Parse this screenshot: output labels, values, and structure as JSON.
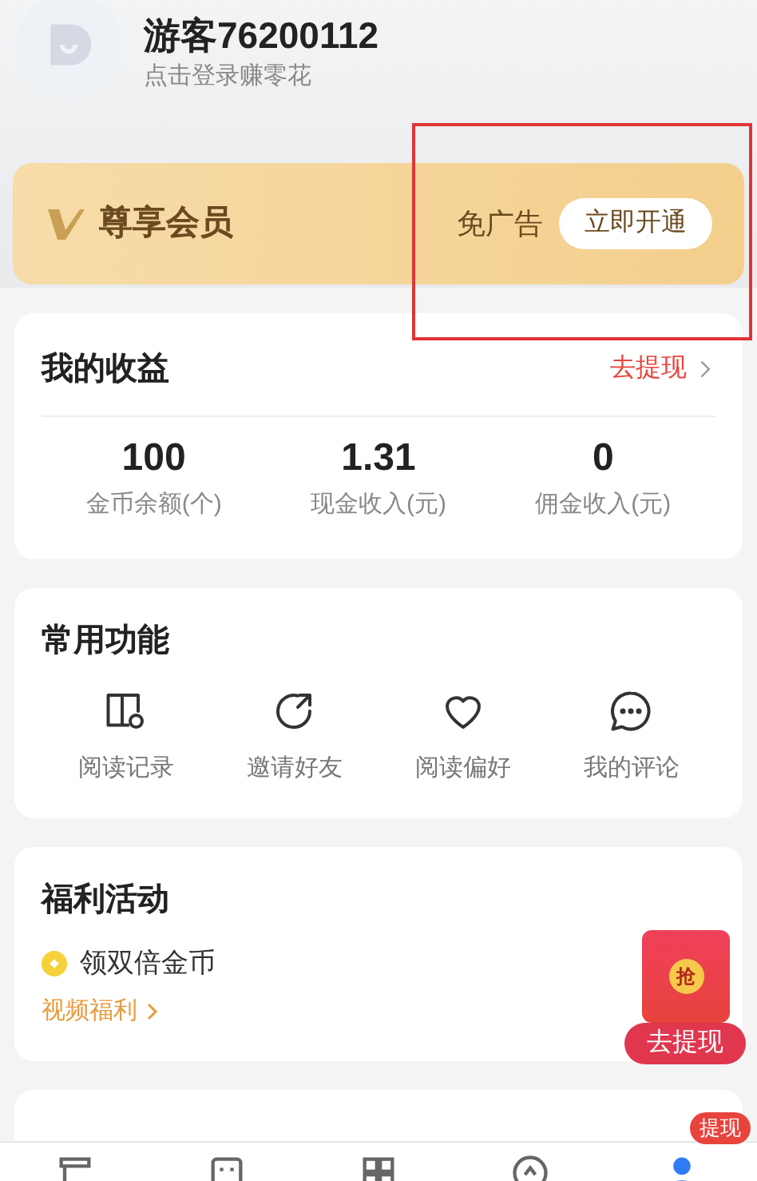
{
  "profile": {
    "name": "游客76200112",
    "subtitle": "点击登录赚零花"
  },
  "vip": {
    "title": "尊享会员",
    "perk": "免广告",
    "button": "立即开通"
  },
  "earnings": {
    "title": "我的收益",
    "link": "去提现",
    "stats": [
      {
        "value": "100",
        "label": "金币余额(个)"
      },
      {
        "value": "1.31",
        "label": "现金收入(元)"
      },
      {
        "value": "0",
        "label": "佣金收入(元)"
      }
    ]
  },
  "functions": {
    "title": "常用功能",
    "items": [
      {
        "kind": "history",
        "label": "阅读记录"
      },
      {
        "kind": "invite",
        "label": "邀请好友"
      },
      {
        "kind": "like",
        "label": "阅读偏好"
      },
      {
        "kind": "comment",
        "label": "我的评论"
      }
    ]
  },
  "welfare": {
    "title": "福利活动",
    "task": "领双倍金币",
    "link": "视频福利"
  },
  "more_services": {
    "kind": "card"
  },
  "float_reward": {
    "icon_text": "抢",
    "button": "去提现"
  },
  "tab_bar": {
    "tabs": [
      {
        "kind": "shelf",
        "selected": false
      },
      {
        "kind": "store",
        "selected": false
      },
      {
        "kind": "category",
        "selected": false
      },
      {
        "kind": "welfare",
        "selected": false
      },
      {
        "kind": "profile",
        "selected": true,
        "badge": "提现"
      }
    ]
  }
}
